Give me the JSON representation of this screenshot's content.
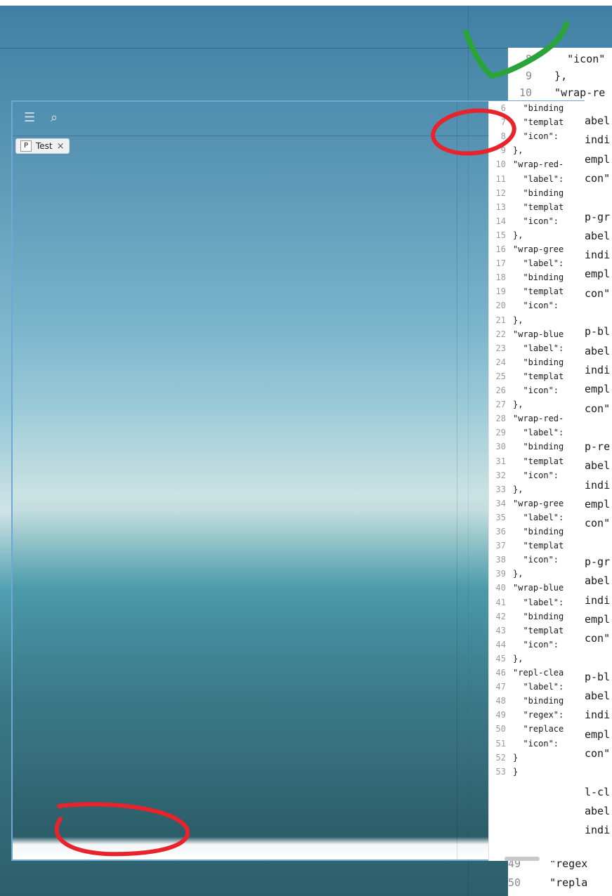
{
  "tab": {
    "chip_letter": "P",
    "label": "Test",
    "close": "×"
  },
  "toolbar": {
    "menu_icon": "☰",
    "search_icon": "⌕"
  },
  "background_editor": {
    "lines": [
      {
        "n": "8",
        "text": "    \"icon\""
      },
      {
        "n": "9",
        "text": "  },"
      },
      {
        "n": "10",
        "text": "  \"wrap-re"
      }
    ],
    "bottom_lines": [
      {
        "n": "49",
        "text": "   \"regex"
      },
      {
        "n": "50",
        "text": "   \"repla"
      }
    ],
    "column_fragments": [
      "abel",
      "indi",
      "empl",
      "con\"",
      "",
      "p-gr",
      "abel",
      "indi",
      "empl",
      "con\"",
      "",
      "p-bl",
      "abel",
      "indi",
      "empl",
      "con\"",
      "",
      "p-re",
      "abel",
      "indi",
      "empl",
      "con\"",
      "",
      "p-gr",
      "abel",
      "indi",
      "empl",
      "con\"",
      "",
      "p-bl",
      "abel",
      "indi",
      "empl",
      "con\"",
      "",
      "l-cl",
      "abel",
      "indi"
    ]
  },
  "front_editor": {
    "lines": [
      {
        "n": "6",
        "text": "  \"binding"
      },
      {
        "n": "7",
        "text": "  \"templat"
      },
      {
        "n": "8",
        "text": "  \"icon\": "
      },
      {
        "n": "9",
        "text": "},"
      },
      {
        "n": "10",
        "text": "\"wrap-red-"
      },
      {
        "n": "11",
        "text": "  \"label\":"
      },
      {
        "n": "12",
        "text": "  \"binding"
      },
      {
        "n": "13",
        "text": "  \"templat"
      },
      {
        "n": "14",
        "text": "  \"icon\": "
      },
      {
        "n": "15",
        "text": "},"
      },
      {
        "n": "16",
        "text": "\"wrap-gree"
      },
      {
        "n": "17",
        "text": "  \"label\":"
      },
      {
        "n": "18",
        "text": "  \"binding"
      },
      {
        "n": "19",
        "text": "  \"templat"
      },
      {
        "n": "20",
        "text": "  \"icon\": "
      },
      {
        "n": "21",
        "text": "},"
      },
      {
        "n": "22",
        "text": "\"wrap-blue"
      },
      {
        "n": "23",
        "text": "  \"label\":"
      },
      {
        "n": "24",
        "text": "  \"binding"
      },
      {
        "n": "25",
        "text": "  \"templat"
      },
      {
        "n": "26",
        "text": "  \"icon\": "
      },
      {
        "n": "27",
        "text": "},"
      },
      {
        "n": "28",
        "text": "\"wrap-red-"
      },
      {
        "n": "29",
        "text": "  \"label\":"
      },
      {
        "n": "30",
        "text": "  \"binding"
      },
      {
        "n": "31",
        "text": "  \"templat"
      },
      {
        "n": "32",
        "text": "  \"icon\": "
      },
      {
        "n": "33",
        "text": "},"
      },
      {
        "n": "34",
        "text": "\"wrap-gree"
      },
      {
        "n": "35",
        "text": "  \"label\":"
      },
      {
        "n": "36",
        "text": "  \"binding"
      },
      {
        "n": "37",
        "text": "  \"templat"
      },
      {
        "n": "38",
        "text": "  \"icon\": "
      },
      {
        "n": "39",
        "text": "},"
      },
      {
        "n": "40",
        "text": "\"wrap-blue"
      },
      {
        "n": "41",
        "text": "  \"label\":"
      },
      {
        "n": "42",
        "text": "  \"binding"
      },
      {
        "n": "43",
        "text": "  \"templat"
      },
      {
        "n": "44",
        "text": "  \"icon\": "
      },
      {
        "n": "45",
        "text": "},"
      },
      {
        "n": "46",
        "text": "\"repl-clea"
      },
      {
        "n": "47",
        "text": "  \"label\":"
      },
      {
        "n": "48",
        "text": "  \"binding"
      },
      {
        "n": "49",
        "text": "  \"regex\":"
      },
      {
        "n": "50",
        "text": "  \"replace"
      },
      {
        "n": "51",
        "text": "  \"icon\": "
      },
      {
        "n": "52",
        "text": "}"
      },
      {
        "n": "53",
        "text": "}"
      }
    ]
  },
  "colors": {
    "annotation_red": "#e8232b",
    "annotation_green": "#2aa33a"
  }
}
